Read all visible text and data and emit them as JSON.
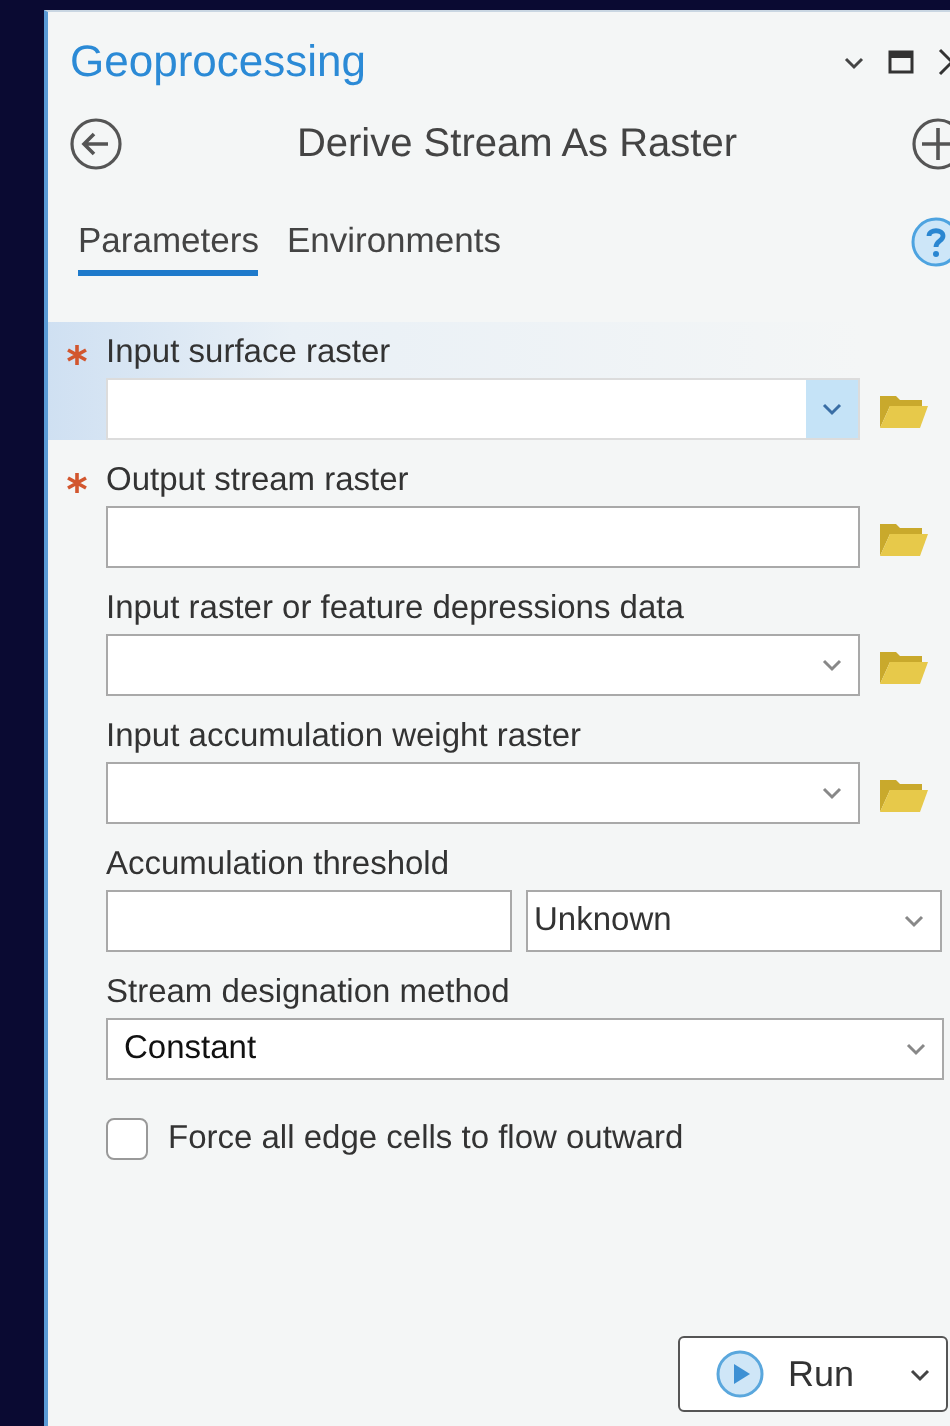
{
  "panel": {
    "title": "Geoprocessing",
    "tool_title": "Derive Stream As Raster"
  },
  "tabs": [
    {
      "label": "Parameters",
      "selected": true
    },
    {
      "label": "Environments",
      "selected": false
    }
  ],
  "parameters": [
    {
      "kind": "combo",
      "label": "Input surface raster",
      "required": true,
      "active": true,
      "browse": true
    },
    {
      "kind": "text",
      "label": "Output stream raster",
      "required": true,
      "active": false,
      "browse": true
    },
    {
      "kind": "combo",
      "label": "Input raster or feature depressions data",
      "required": false,
      "active": false,
      "browse": true
    },
    {
      "kind": "combo",
      "label": "Input accumulation weight raster",
      "required": false,
      "active": false,
      "browse": true
    },
    {
      "kind": "threshold",
      "label": "Accumulation threshold",
      "required": false,
      "active": false,
      "unit": "Unknown"
    },
    {
      "kind": "dropdown",
      "label": "Stream designation method",
      "required": false,
      "active": false,
      "value": "Constant"
    },
    {
      "kind": "checkbox",
      "label": "Force all edge cells to flow outward",
      "checked": false
    }
  ],
  "run_button": {
    "label": "Run"
  }
}
